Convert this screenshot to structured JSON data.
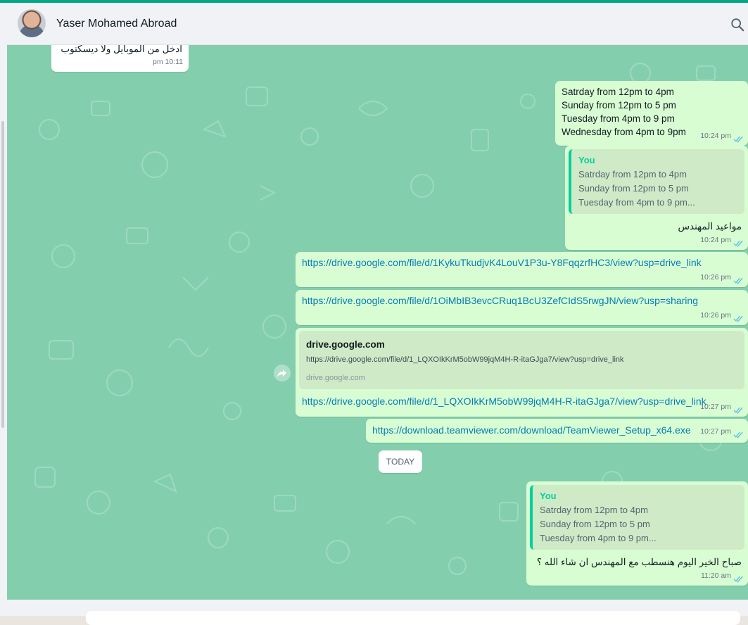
{
  "header": {
    "contact_name": "Yaser Mohamed Abroad"
  },
  "colors": {
    "accent": "#00a884",
    "chat_background": "#83cfad",
    "outgoing_bubble": "#d9fdd3",
    "incoming_bubble": "#ffffff",
    "link": "#027eb5",
    "read_ticks": "#53bdeb"
  },
  "icons": {
    "search": "search-icon",
    "forward": "forward-icon",
    "read_receipt": "double-check-icon"
  },
  "messages": [
    {
      "direction": "in",
      "text": "ادخل من الموبايل ولا ديسكتوب",
      "time": "10:11 pm"
    },
    {
      "direction": "out",
      "lines": [
        "Satrday from 12pm to 4pm",
        "Sunday from 12pm to 5 pm",
        "Tuesday from 4pm to 9 pm",
        "Wednesday from 4pm to 9pm"
      ],
      "time": "10:24 pm"
    },
    {
      "direction": "out",
      "quote_author": "You",
      "quote_lines": [
        "Satrday from 12pm to 4pm",
        "Sunday from 12pm to 5 pm",
        "Tuesday from 4pm to 9 pm..."
      ],
      "text": "مواعيد المهندس",
      "time": "10:24 pm"
    },
    {
      "direction": "out",
      "link": "https://drive.google.com/file/d/1KykuTkudjvK4LouV1P3u-Y8FqqzrfHC3/view?usp=drive_link",
      "time": "10:26 pm"
    },
    {
      "direction": "out",
      "link": "https://drive.google.com/file/d/1OiMbIB3evcCRuq1BcU3ZefCIdS5rwgJN/view?usp=sharing",
      "time": "10:26 pm"
    },
    {
      "direction": "out",
      "preview_title": "drive.google.com",
      "preview_url": "https://drive.google.com/file/d/1_LQXOIkKrM5obW99jqM4H-R-itaGJga7/view?usp=drive_link",
      "preview_domain": "drive.google.com",
      "link": "https://drive.google.com/file/d/1_LQXOIkKrM5obW99jqM4H-R-itaGJga7/view?usp=drive_link",
      "time": "10:27 pm"
    },
    {
      "direction": "out",
      "link": "https://download.teamviewer.com/download/TeamViewer_Setup_x64.exe",
      "time": "10:27 pm"
    },
    {
      "direction": "out",
      "quote_author": "You",
      "quote_lines": [
        "Satrday from 12pm to 4pm",
        "Sunday from 12pm to 5 pm",
        "Tuesday from 4pm to 9 pm..."
      ],
      "text": "صباح الخير اليوم هنسطب مع المهندس ان شاء الله ؟",
      "time": "11:20 am"
    }
  ],
  "date_divider": "TODAY"
}
